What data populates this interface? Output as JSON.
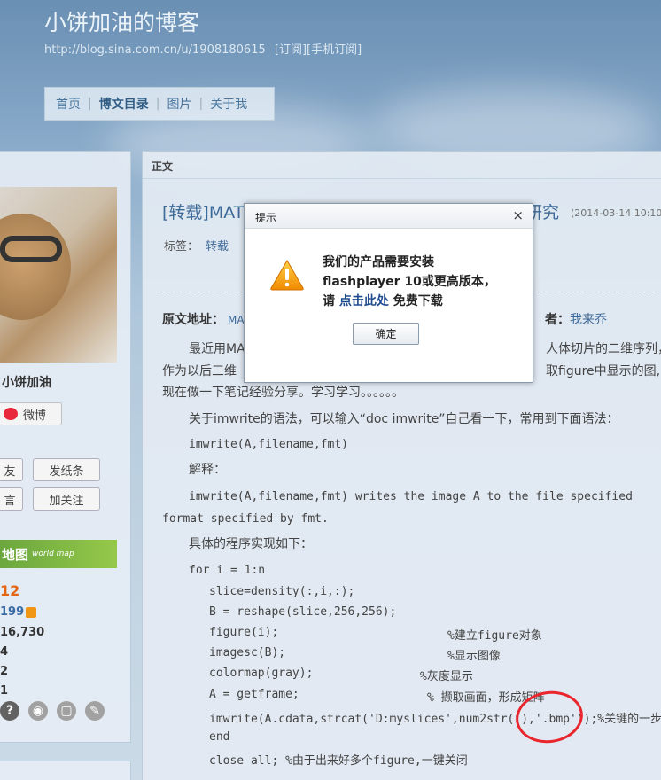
{
  "header": {
    "blog_title": "小饼加油的博客",
    "url": "http://blog.sina.com.cn/u/1908180615",
    "subscribe": "[订阅]",
    "mobile_subscribe": "[手机订阅]"
  },
  "nav": {
    "items": [
      "首页",
      "博文目录",
      "图片",
      "关于我"
    ]
  },
  "sidebar": {
    "user_name": "小饼加油",
    "weibo_label": "微博",
    "btn_friend": "友",
    "btn_note": "发纸条",
    "btn_message": "言",
    "btn_follow": "加关注",
    "map_text": "地图",
    "map_sub": "world map",
    "stats": [
      "12",
      "199",
      "16,730",
      "4",
      "2",
      "1"
    ]
  },
  "main": {
    "tab": "正文",
    "post_title": "[转载]MATLAB中用imwrite函数批量保存图片的研究",
    "post_date": "(2014-03-14 10:10:49)",
    "tags_label": "标签：",
    "tag": "转载",
    "source_label": "原文地址：",
    "source_link": "MA",
    "author_label": "者：",
    "author_name": "我来乔",
    "para1_a": "最近用MA",
    "para1_b": "人体切片的二维序列，",
    "para2_a": "作为以后三维",
    "para2_b": "取figure中显示的图,",
    "para3": "现在做一下笔记经验分享。学习学习。。。。。。",
    "para4": "关于imwrite的语法，可以输入“doc imwrite”自己看一下，常用到下面语法：",
    "code1": "imwrite(A,filename,fmt)",
    "explain": "解释：",
    "code2": "imwrite(A,filename,fmt) writes the image A to the file specified",
    "code3": "format specified by fmt.",
    "para5": "具体的程序实现如下：",
    "code_lines": [
      "for i = 1:n",
      "slice=density(:,i,:);",
      "B = reshape(slice,256,256);",
      "figure(i);",
      "imagesc(B);",
      "colormap(gray);",
      "A = getframe;",
      "imwrite(A.cdata,strcat('D:myslices',num2str(i),'.bmp'));%关键的一步",
      "end",
      "close all; %由于出来好多个figure,一键关闭"
    ],
    "comments": [
      "%建立figure对象",
      "%显示图像",
      "%灰度显示",
      "% 撷取画面，形成矩阵"
    ]
  },
  "dialog": {
    "title": "提示",
    "close": "×",
    "line1": "我们的产品需要安装",
    "line2": "flashplayer 10或更高版本，",
    "line3_a": "请 ",
    "line3_link": "点击此处",
    "line3_b": " 免费下载",
    "ok": "确定"
  }
}
